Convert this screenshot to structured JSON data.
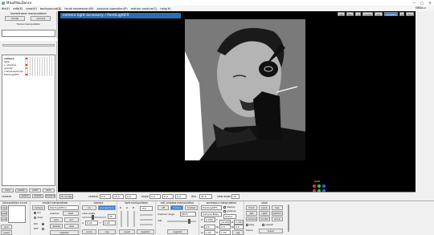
{
  "window": {
    "title": "MikuMikuDance",
    "controls": [
      "—",
      "□",
      "✕"
    ]
  },
  "menu": {
    "items": [
      "file(F)",
      "edit(E)",
      "view(V)",
      "background(B)",
      "facial expression(M)",
      "physical operation(P)",
      "motion capture(C)",
      "help(H)"
    ],
    "version": "MMDv.x"
  },
  "left_panel": {
    "header": "bone/frame manipulation",
    "buttons": [
      "model",
      "camera"
    ],
    "subheader": "frame manipulation",
    "tracks": [
      "camera",
      "light",
      "s. shadow",
      "gravity",
      "s.Shadow/Scale",
      "PointLightFX"
    ],
    "bottom_buttons": [
      "copy",
      "paste",
      "undo",
      "redo"
    ],
    "bottom_row": {
      "label": "camera",
      "buttons": [
        "select",
        "delete",
        "expand"
      ]
    }
  },
  "viewport": {
    "tab": "camera light accessory / PointLightFX",
    "top_buttons": [
      {
        "label": "upt",
        "on": false
      },
      {
        "label": "Rev",
        "on": false
      },
      {
        "label": "%",
        "on": false
      },
      {
        "label": "wndw",
        "on": false
      },
      {
        "label": "info",
        "on": false
      },
      {
        "label": "cam/pan",
        "on": true
      },
      {
        "label": "fs",
        "on": false
      },
      {
        "label": "fold",
        "on": false
      }
    ],
    "local_label": "local",
    "bottom": {
      "to_model": "To model",
      "camera_label": "camera",
      "camera_values": [
        "0.0",
        "10.0",
        "0.0"
      ],
      "angle_label": "angle",
      "angle_values": [
        "0.0",
        "0.0",
        "0.0"
      ],
      "dist_label": "dist",
      "dist_value": "45.0",
      "fov_label": "view angle",
      "fov_value": "30"
    }
  },
  "bottom_panels": {
    "interpolation": {
      "title": "Interpolation curve",
      "buttons": [
        "copy",
        "paste",
        "auto",
        "pos",
        "reset"
      ],
      "on_label": "ON",
      "off_label": "OFF"
    },
    "model_manip": {
      "title": "model manipulation",
      "field": "PointLightFX.x",
      "buttons": [
        "camera",
        "load",
        "delete",
        "register",
        "aux",
        "acc"
      ],
      "labels": [
        "acc",
        "draw",
        "shadow",
        "add"
      ]
    },
    "camera": {
      "title": "camera",
      "buttons": [
        "on",
        "perspective",
        "undo",
        "reg"
      ],
      "labels": [
        "view angle",
        "X",
        "Y",
        "Z"
      ],
      "values": [
        "30",
        "0.00",
        "0.00"
      ]
    },
    "light": {
      "title": "light manipulation",
      "labels": [
        "R",
        "G",
        "B"
      ],
      "buttons": [
        "reset",
        "register"
      ],
      "value": "154"
    },
    "shadow": {
      "title": "self_shadow manipulation",
      "buttons": [
        "off",
        "mode1",
        "mode2"
      ],
      "labels": [
        "shadow range",
        "dist"
      ],
      "field": "8875",
      "register": "register"
    },
    "accessory": {
      "title": "accessory manipulation",
      "field": "PointLightFX",
      "buttons": [
        "display",
        "shadow",
        "delete",
        "reg"
      ],
      "fields": [
        "Camera Base",
        "Scene"
      ],
      "labels": [
        "X",
        "Y",
        "Z",
        "Rx",
        "Ry",
        "Rz",
        "Si",
        "Tr"
      ],
      "values": [
        "0.000",
        "10.000",
        "0.000",
        "0.0",
        "0.0",
        "0.0",
        "1.00",
        "1.00"
      ]
    },
    "view": {
      "title": "view",
      "buttons": [
        "front",
        "back",
        "top",
        "left",
        "right",
        "bottom",
        "camera",
        "model",
        "bone",
        "track"
      ],
      "labels": [
        "play",
        "repeat",
        "frame"
      ]
    }
  },
  "colors": {
    "accent": "#3a7fd0",
    "tab": "#2b6fb3",
    "viewport_bg": "#000000",
    "scene_bg": "#7a7a7a"
  }
}
